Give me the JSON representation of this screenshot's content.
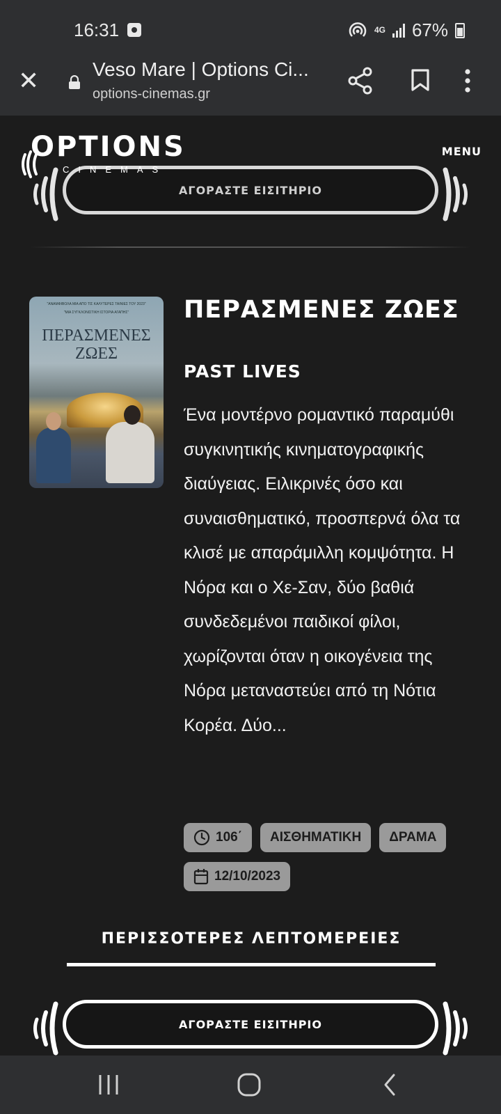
{
  "status_bar": {
    "time": "16:31",
    "network": "4G",
    "battery": "67%"
  },
  "browser": {
    "page_title": "Veso Mare | Options Ci...",
    "url": "options-cinemas.gr"
  },
  "site": {
    "logo_text": "OPTIONS",
    "logo_sub": "CINEMAS",
    "menu_label": "MENU",
    "ticket_button": "ΑΓΟΡΑΣΤΕ ΕΙΣΙΤΗΡΙΟ"
  },
  "movie": {
    "title": "ΠΕΡΑΣΜΕΝΕΣ ΖΩΕΣ",
    "original_title": "PAST LIVES",
    "synopsis": "Ένα μοντέρνο ρομαντικό παραμύθι συγκινητικής κινηματογραφικής διαύγειας. Ειλικρινές όσο και συναισθηματικό, προσπερνά όλα τα κλισέ με απαράμιλλη κομψότητα. Η Νόρα και ο Χε-Σαν, δύο βαθιά συνδεδεμένοι παιδικοί φίλοι, χωρίζονται όταν η οικογένεια της Νόρα μεταναστεύει από τη Νότια Κορέα. Δύο...",
    "duration": "106΄",
    "genre_1": "ΑΙΣΘΗΜΑΤΙΚΗ",
    "genre_2": "ΔΡΑΜΑ",
    "release_date": "12/10/2023",
    "poster": {
      "quote_1": "\"ΑΝΑΜΦΙΒΟΛΑ ΜΙΑ ΑΠΟ ΤΙΣ ΚΑΛΥΤΕΡΕΣ ΤΑΙΝΙΕΣ ΤΟΥ 2023\"",
      "quote_2": "\"ΜΙΑ ΣΥΓΚΛΟΝΙΣΤΙΚΗ ΙΣΤΟΡΙΑ ΑΓΑΠΗΣ\"",
      "title_line_1": "ΠΕΡΑΣΜΕΝΕΣ",
      "title_line_2": "ΖΩΕΣ"
    }
  },
  "more_details": "ΠΕΡΙΣΣΟΤΕΡΕΣ ΛΕΠΤΟΜΕΡΕΙΕΣ",
  "colors": {
    "background": "#1c1c1c",
    "chrome": "#2e2f31",
    "tag_bg": "#9a9a9a",
    "text": "#ffffff"
  }
}
